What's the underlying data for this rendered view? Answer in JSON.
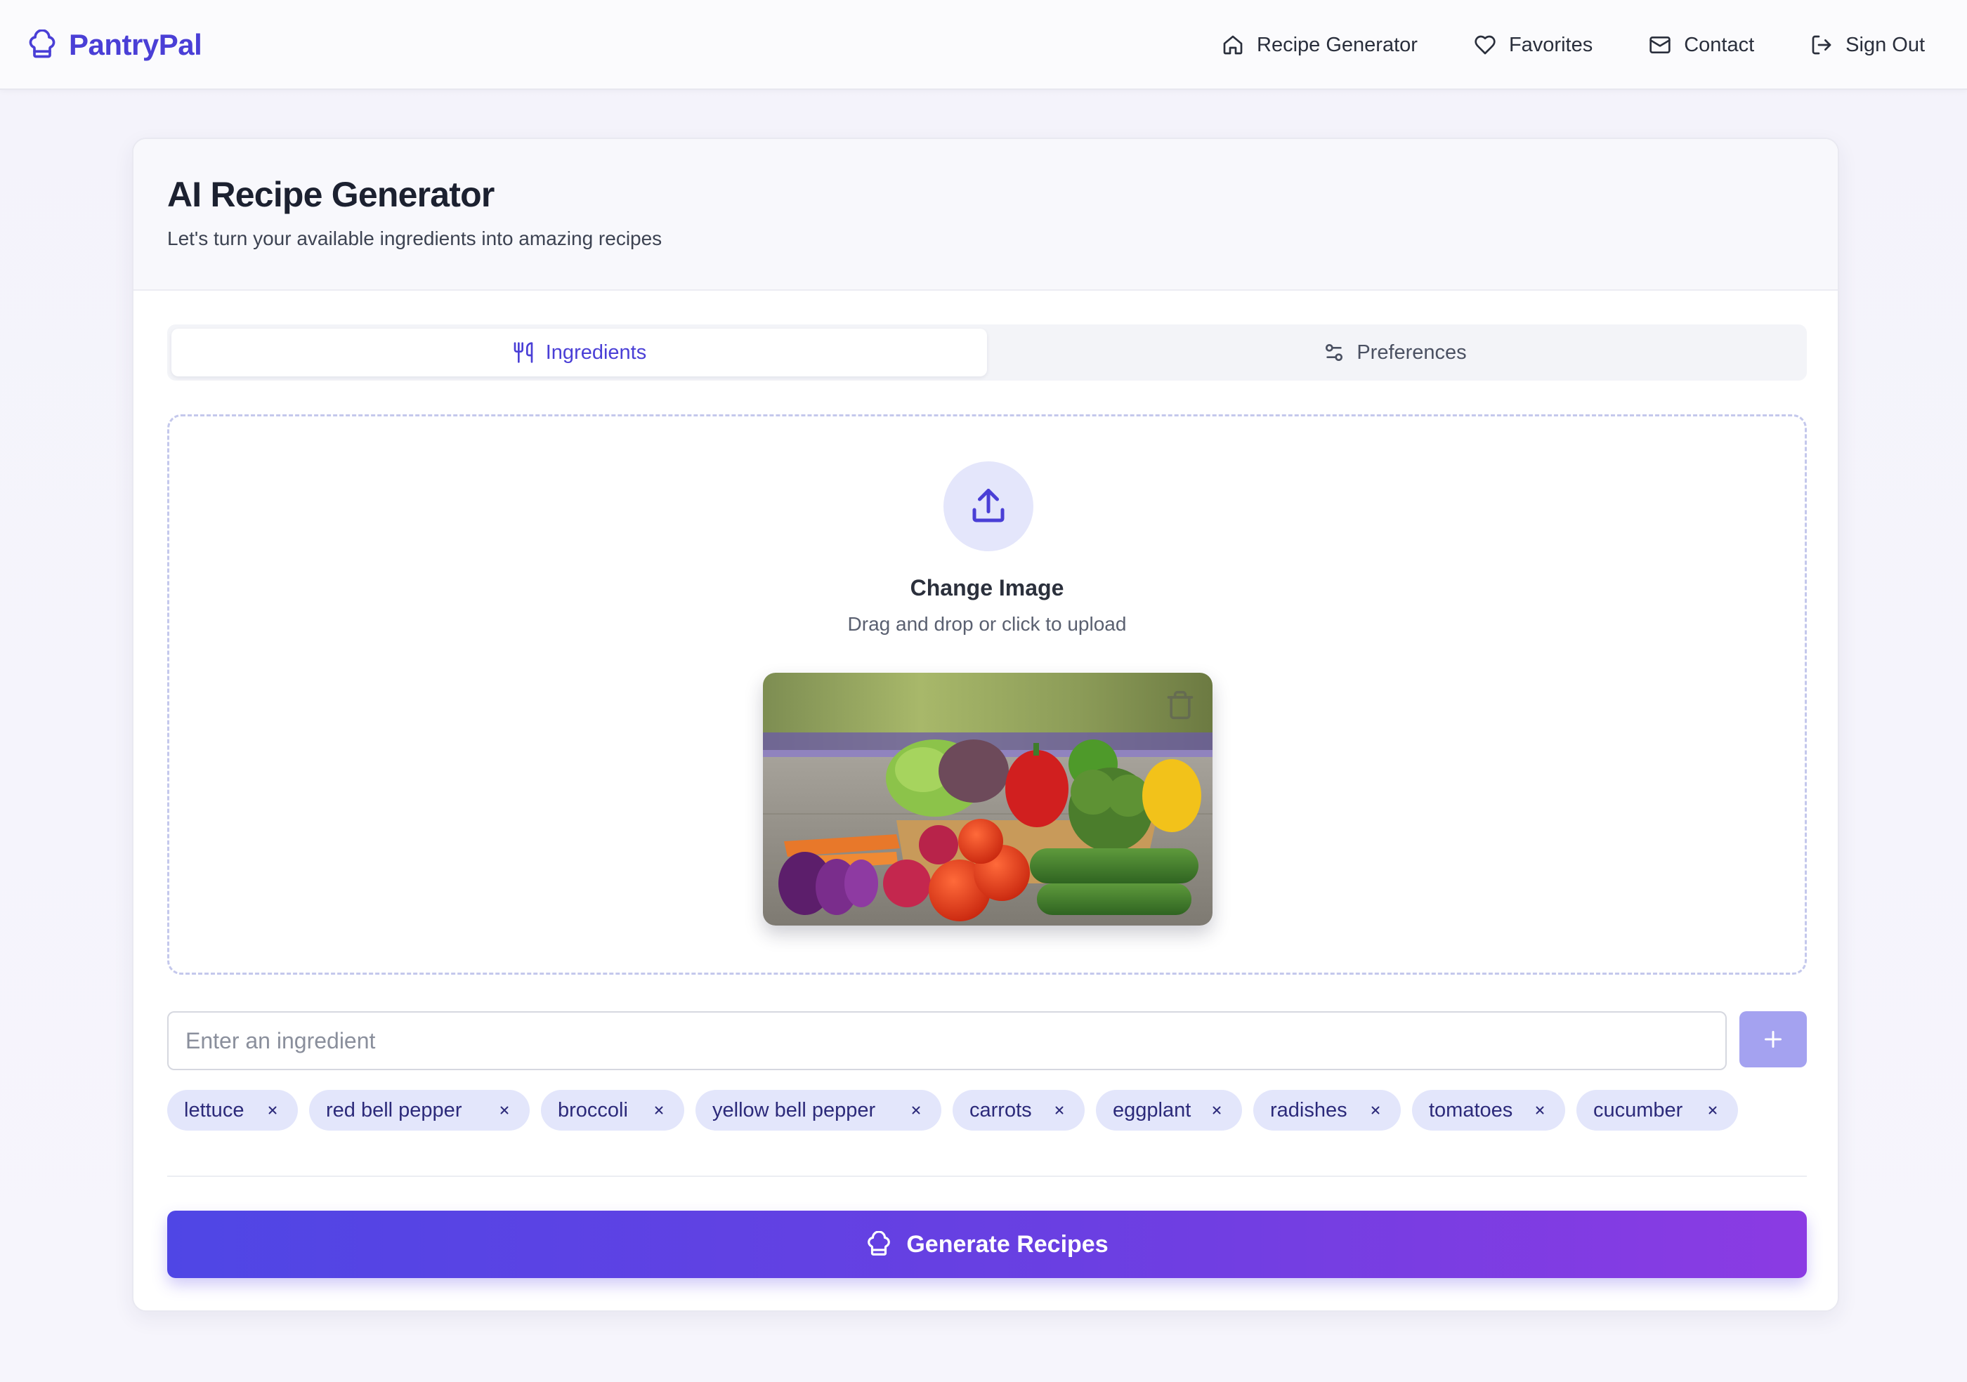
{
  "brand": {
    "name": "PantryPal",
    "icon": "chef-hat-icon",
    "color": "#4a3fd6"
  },
  "nav": {
    "items": [
      {
        "label": "Recipe Generator",
        "icon": "home-icon"
      },
      {
        "label": "Favorites",
        "icon": "heart-icon"
      },
      {
        "label": "Contact",
        "icon": "mail-icon"
      },
      {
        "label": "Sign Out",
        "icon": "sign-out-icon"
      }
    ]
  },
  "header": {
    "title": "AI Recipe Generator",
    "subtitle": "Let's turn your available ingredients into amazing recipes"
  },
  "tabs": [
    {
      "label": "Ingredients",
      "icon": "utensils-icon",
      "active": true
    },
    {
      "label": "Preferences",
      "icon": "sliders-icon",
      "active": false
    }
  ],
  "upload": {
    "title": "Change Image",
    "hint": "Drag and drop or click to upload",
    "icon": "upload-icon"
  },
  "ingredient_input": {
    "placeholder": "Enter an ingredient",
    "value": ""
  },
  "ingredients": [
    "lettuce",
    "red bell pepper",
    "broccoli",
    "yellow bell pepper",
    "carrots",
    "eggplant",
    "radishes",
    "tomatoes",
    "cucumber"
  ],
  "generate": {
    "label": "Generate Recipes",
    "icon": "chef-hat-icon"
  },
  "colors": {
    "accent": "#4a3fd6",
    "gradient_start": "#4f46e5",
    "gradient_end": "#8b3be3",
    "chip_bg": "#e3e6fb"
  }
}
